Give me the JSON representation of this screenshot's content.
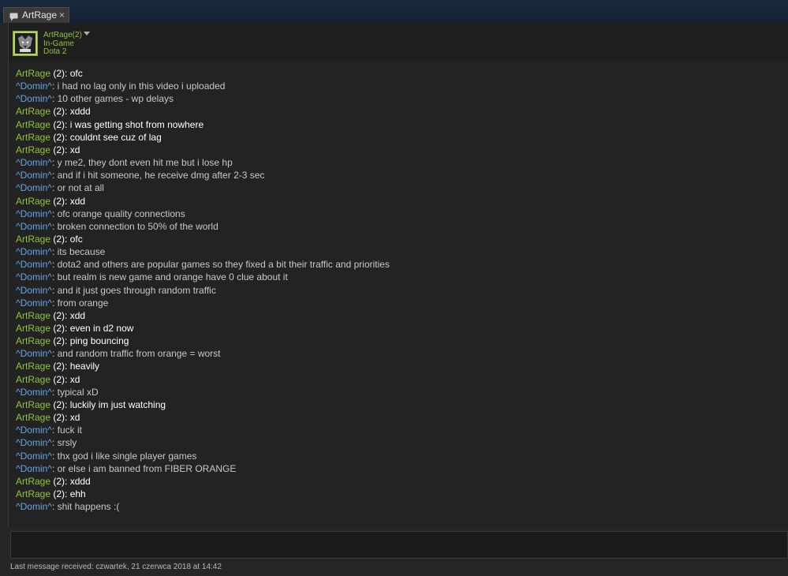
{
  "tab": {
    "label": "ArtRage",
    "close": "×",
    "icon": "chat-bubble-icon"
  },
  "header": {
    "name": "ArtRage(2)",
    "status": "In-Game",
    "game": "Dota 2",
    "avatar_icon": "wolf-avatar-icon"
  },
  "colors": {
    "me": "#8fc43a",
    "friend": "#62a7e3",
    "background": "#262626"
  },
  "messages": [
    {
      "sender": "ArtRage",
      "suffix": " (2): ",
      "text": "ofc",
      "who": "me"
    },
    {
      "sender": "^Domin^",
      "suffix": ": ",
      "text": "i had no lag only in this video i uploaded",
      "who": "friend"
    },
    {
      "sender": "^Domin^",
      "suffix": ": ",
      "text": "10 other games - wp delays",
      "who": "friend"
    },
    {
      "sender": "ArtRage",
      "suffix": " (2): ",
      "text": "xddd",
      "who": "me"
    },
    {
      "sender": "ArtRage",
      "suffix": " (2): ",
      "text": "i was getting shot from nowhere",
      "who": "me"
    },
    {
      "sender": "ArtRage",
      "suffix": " (2): ",
      "text": "couldnt see cuz of lag",
      "who": "me"
    },
    {
      "sender": "ArtRage",
      "suffix": " (2): ",
      "text": "xd",
      "who": "me"
    },
    {
      "sender": "^Domin^",
      "suffix": ": ",
      "text": "y me2, they dont even hit me but i lose hp",
      "who": "friend"
    },
    {
      "sender": "^Domin^",
      "suffix": ": ",
      "text": "and if i hit someone, he receive dmg after 2-3 sec",
      "who": "friend"
    },
    {
      "sender": "^Domin^",
      "suffix": ": ",
      "text": "or not at all",
      "who": "friend"
    },
    {
      "sender": "ArtRage",
      "suffix": " (2): ",
      "text": "xdd",
      "who": "me"
    },
    {
      "sender": "^Domin^",
      "suffix": ": ",
      "text": "ofc orange quality connections",
      "who": "friend"
    },
    {
      "sender": "^Domin^",
      "suffix": ": ",
      "text": "broken connection to 50% of the world",
      "who": "friend"
    },
    {
      "sender": "ArtRage",
      "suffix": " (2): ",
      "text": "ofc",
      "who": "me"
    },
    {
      "sender": "^Domin^",
      "suffix": ": ",
      "text": "its because",
      "who": "friend"
    },
    {
      "sender": "^Domin^",
      "suffix": ": ",
      "text": "dota2 and others are popular games so they fixed a bit their traffic and priorities",
      "who": "friend"
    },
    {
      "sender": "^Domin^",
      "suffix": ": ",
      "text": "but realm is new game and orange have 0 clue about it",
      "who": "friend"
    },
    {
      "sender": "^Domin^",
      "suffix": ": ",
      "text": "and it just goes through random traffic",
      "who": "friend"
    },
    {
      "sender": "^Domin^",
      "suffix": ": ",
      "text": "from orange",
      "who": "friend"
    },
    {
      "sender": "ArtRage",
      "suffix": " (2): ",
      "text": "xdd",
      "who": "me"
    },
    {
      "sender": "ArtRage",
      "suffix": " (2): ",
      "text": "even in d2 now",
      "who": "me"
    },
    {
      "sender": "ArtRage",
      "suffix": " (2): ",
      "text": "ping bouncing",
      "who": "me"
    },
    {
      "sender": "^Domin^",
      "suffix": ": ",
      "text": "and random traffic from orange = worst",
      "who": "friend"
    },
    {
      "sender": "ArtRage",
      "suffix": " (2): ",
      "text": "heavily",
      "who": "me"
    },
    {
      "sender": "ArtRage",
      "suffix": " (2): ",
      "text": "xd",
      "who": "me"
    },
    {
      "sender": "^Domin^",
      "suffix": ": ",
      "text": "typical xD",
      "who": "friend"
    },
    {
      "sender": "ArtRage",
      "suffix": " (2): ",
      "text": "luckily im just watching",
      "who": "me"
    },
    {
      "sender": "ArtRage",
      "suffix": " (2): ",
      "text": "xd",
      "who": "me"
    },
    {
      "sender": "^Domin^",
      "suffix": ": ",
      "text": "fuck it",
      "who": "friend"
    },
    {
      "sender": "^Domin^",
      "suffix": ": ",
      "text": "srsly",
      "who": "friend"
    },
    {
      "sender": "^Domin^",
      "suffix": ": ",
      "text": "thx god i like single player games",
      "who": "friend"
    },
    {
      "sender": "^Domin^",
      "suffix": ": ",
      "text": "or else i am banned from FIBER ORANGE",
      "who": "friend"
    },
    {
      "sender": "ArtRage",
      "suffix": " (2): ",
      "text": "xddd",
      "who": "me"
    },
    {
      "sender": "ArtRage",
      "suffix": " (2): ",
      "text": "ehh",
      "who": "me"
    },
    {
      "sender": "^Domin^",
      "suffix": ": ",
      "text": "shit happens :(",
      "who": "friend"
    }
  ],
  "input": {
    "value": "",
    "placeholder": ""
  },
  "footer": {
    "text": "Last message received: czwartek, 21 czerwca 2018 at 14:42"
  }
}
